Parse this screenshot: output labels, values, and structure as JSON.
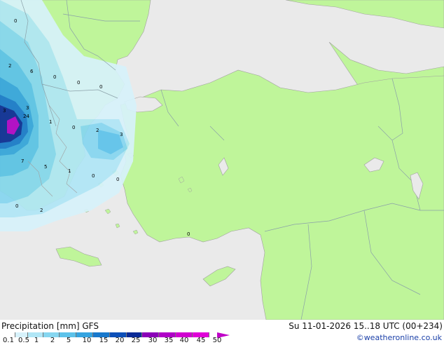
{
  "map": {
    "colors": {
      "land": "#bff59a",
      "sea": "#eaeaea",
      "border": "#8aa0a8",
      "coast": "#a0a0a0"
    },
    "value_labels": [
      "0",
      "2",
      "6",
      "0",
      "0",
      "0",
      "3",
      "3",
      "24",
      "1",
      "0",
      "2",
      "3",
      "7",
      "5",
      "1",
      "0",
      "0",
      "0",
      "2",
      "0"
    ]
  },
  "footer": {
    "title": "Precipitation [mm] GFS",
    "datetime": "Su 11-01-2026 15..18 UTC (00+234)",
    "credit": "©weatheronline.co.uk"
  },
  "legend": {
    "ticks": [
      "0.1",
      "0.5",
      "1",
      "2",
      "5",
      "10",
      "15",
      "20",
      "25",
      "30",
      "35",
      "40",
      "45",
      "50"
    ],
    "colors": [
      "#ffffff",
      "#d7f2fb",
      "#b0e6f6",
      "#86d6f0",
      "#5cc2ea",
      "#35a3df",
      "#1878cc",
      "#0c4fb8",
      "#0a2a96",
      "#8a00b8",
      "#b000c8",
      "#d000d0",
      "#e000d8"
    ]
  }
}
